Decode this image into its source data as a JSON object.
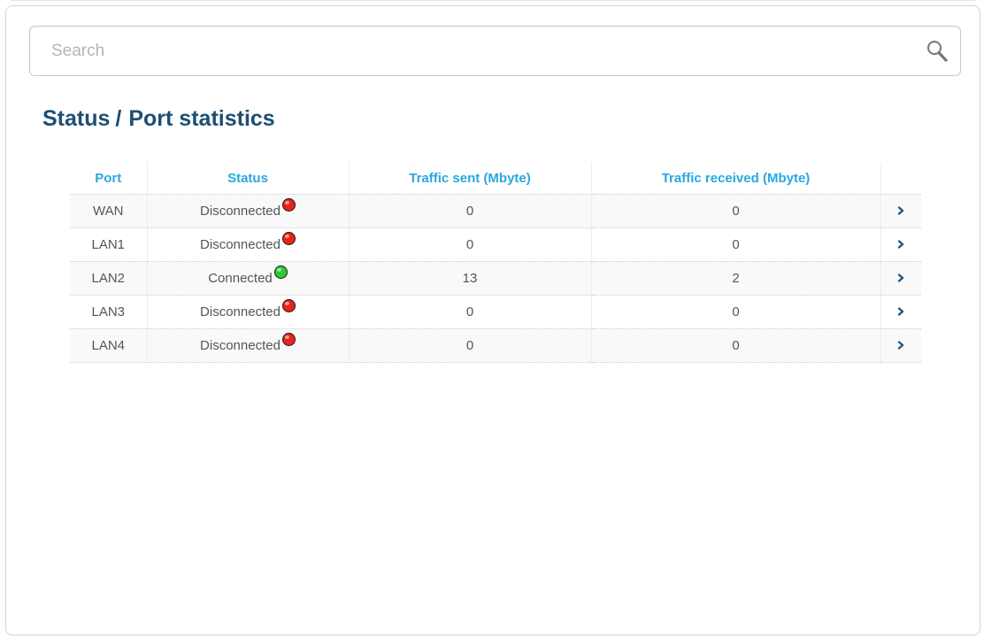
{
  "search": {
    "placeholder": "Search",
    "icon": "search-icon"
  },
  "breadcrumb": {
    "section": "Status",
    "separator": "/",
    "page": "Port statistics"
  },
  "table": {
    "columns": [
      "Port",
      "Status",
      "Traffic sent (Mbyte)",
      "Traffic received (Mbyte)",
      ""
    ],
    "rows": [
      {
        "port": "WAN",
        "status": "Disconnected",
        "status_color": "#e8231b",
        "sent": "0",
        "received": "0"
      },
      {
        "port": "LAN1",
        "status": "Disconnected",
        "status_color": "#e8231b",
        "sent": "0",
        "received": "0"
      },
      {
        "port": "LAN2",
        "status": "Connected",
        "status_color": "#2ec92e",
        "sent": "13",
        "received": "2"
      },
      {
        "port": "LAN3",
        "status": "Disconnected",
        "status_color": "#e8231b",
        "sent": "0",
        "received": "0"
      },
      {
        "port": "LAN4",
        "status": "Disconnected",
        "status_color": "#e8231b",
        "sent": "0",
        "received": "0"
      }
    ]
  },
  "colors": {
    "title": "#1d4f73",
    "header": "#29a7e1",
    "cell_text": "#555555",
    "chevron": "#1d5a8a"
  },
  "icons": {
    "status": "status-dot-icon",
    "row_action": "chevron-right-icon"
  }
}
